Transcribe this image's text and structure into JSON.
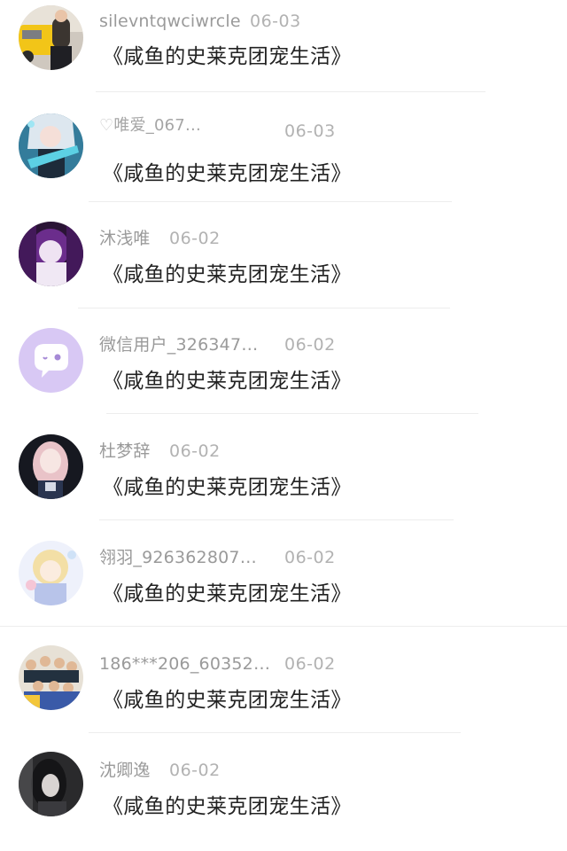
{
  "comments": [
    {
      "user": "silevntqwciwrcle",
      "date": "06-03",
      "text": "《咸鱼的史莱克团宠生活》",
      "avatar_icon": "yellow-car-photo-avatar"
    },
    {
      "user": "唯爱_067…",
      "date": "06-03",
      "text": "《咸鱼的史莱克团宠生活》",
      "avatar_icon": "anime-girl-guitar-avatar"
    },
    {
      "user": "沐浅唯",
      "date": "06-02",
      "text": "《咸鱼的史莱克团宠生活》",
      "avatar_icon": "purple-anime-avatar"
    },
    {
      "user": "微信用户_326347…",
      "date": "06-02",
      "text": "《咸鱼的史莱克团宠生活》",
      "avatar_icon": "chat-bubble-default-avatar"
    },
    {
      "user": "杜梦辞",
      "date": "06-02",
      "text": "《咸鱼的史莱克团宠生活》",
      "avatar_icon": "pink-hair-girl-avatar"
    },
    {
      "user": "翎羽_926362807…",
      "date": "06-02",
      "text": "《咸鱼的史莱克团宠生活》",
      "avatar_icon": "pastel-anime-avatar"
    },
    {
      "user": "186***206_60352…",
      "date": "06-02",
      "text": "《咸鱼的史莱克团宠生活》",
      "avatar_icon": "group-photo-avatar"
    },
    {
      "user": "沈卿逸",
      "date": "06-02",
      "text": "《咸鱼的史莱克团宠生活》",
      "avatar_icon": "dark-portrait-avatar"
    }
  ],
  "colors": {
    "username": "#9a9a9a",
    "date": "#b2b2b2",
    "content": "#222222",
    "divider": "#ededed",
    "default_avatar_bg": "#d8c8f4"
  }
}
